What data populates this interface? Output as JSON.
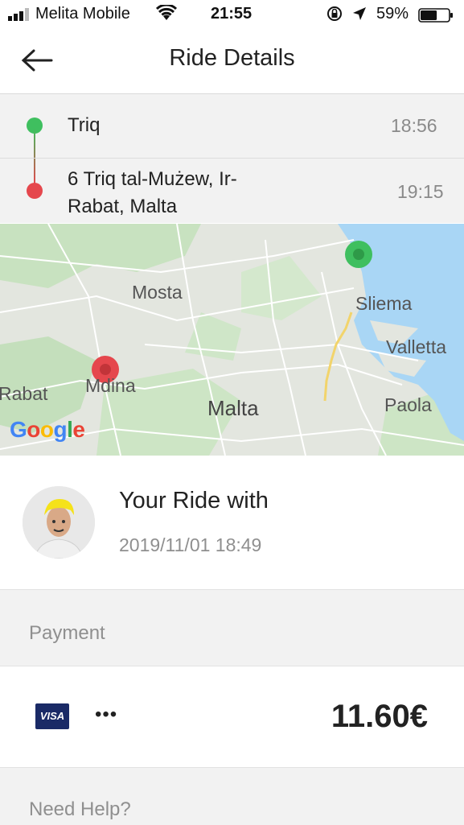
{
  "status_bar": {
    "carrier": "Melita Mobile",
    "time": "21:55",
    "battery_percent": "59%",
    "battery_level": 0.59
  },
  "header": {
    "title": "Ride Details",
    "back_icon": "arrow-left-icon"
  },
  "route": {
    "pickup": {
      "address": "Triq",
      "time": "18:56",
      "color": "#3fbf5f"
    },
    "dropoff": {
      "address_line1": "6 Triq tal-Mużew, Ir-",
      "address_line2": "Rabat, Malta",
      "time": "19:15",
      "color": "#e5474d"
    }
  },
  "map": {
    "labels": [
      "Mosta",
      "Sliema",
      "Valletta",
      "Rabat",
      "Mdina",
      "Malta",
      "Paola"
    ],
    "attribution": "Google"
  },
  "ride": {
    "title": "Your Ride with",
    "date": "2019/11/01 18:49"
  },
  "payment": {
    "section_label": "Payment",
    "card_brand": "VISA",
    "card_mask": "•••",
    "amount": "11.60€"
  },
  "help": {
    "label": "Need Help?"
  }
}
